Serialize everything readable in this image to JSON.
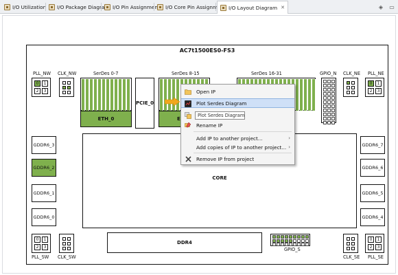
{
  "tabs": [
    {
      "label": "I/O Utilization",
      "active": false
    },
    {
      "label": "I/O Package Diagram",
      "active": false
    },
    {
      "label": "I/O Pin Assignment",
      "active": false
    },
    {
      "label": "I/O Core Pin Assignment",
      "active": false
    },
    {
      "label": "I/O Layout Diagram",
      "active": true,
      "close": "✕"
    }
  ],
  "chip": {
    "title": "AC7t1500ES0-FS3",
    "top_labels": {
      "pll_nw": "PLL_NW",
      "clk_nw": "CLK_NW",
      "serdes_0_7": "SerDes 0-7",
      "serdes_8_15": "SerDes 8-15",
      "serdes_16_31": "SerDes 16-31",
      "gpio_n": "GPIO_N",
      "clk_ne": "CLK_NE",
      "pll_ne": "PLL_NE"
    },
    "pll_nw_cells": [
      "0",
      "1",
      "2",
      "3"
    ],
    "pll_ne_cells": [
      "0",
      "1",
      "2",
      "3"
    ],
    "pll_sw_cells": [
      "0",
      "1",
      "2",
      "3"
    ],
    "pll_se_cells": [
      "0",
      "1",
      "2",
      "3"
    ],
    "eth_0": "ETH_0",
    "pcie_0": "PCIE_0",
    "eth_1_partial": "E",
    "left_gddr": [
      "GDDR6_3",
      "GDDR6_2",
      "GDDR6_1",
      "GDDR6_0"
    ],
    "right_gddr": [
      "GDDR6_7",
      "GDDR6_6",
      "GDDR6_5",
      "GDDR6_4"
    ],
    "core": "CORE",
    "ddr4": "DDR4",
    "bottom_labels": {
      "pll_sw": "PLL_SW",
      "clk_sw": "CLK_SW",
      "gpio_s": "GPIO_S",
      "clk_se": "CLK_SE",
      "pll_se": "PLL_SE"
    }
  },
  "context_menu": {
    "items": [
      {
        "label": "Open IP",
        "icon": "folder-open-icon"
      },
      {
        "label": "Plot Serdes Diagram",
        "icon": "plot-icon",
        "highlighted": true
      },
      {
        "label": "",
        "icon": "copy-icon"
      },
      {
        "label": "Rename IP",
        "icon": "rename-icon"
      },
      {
        "label": "Add IP to another project...",
        "submenu": "›"
      },
      {
        "label": "Add copies of IP to another project...",
        "submenu": "›"
      },
      {
        "label": "Remove IP from project",
        "icon": "remove-icon"
      }
    ],
    "tooltip": "Plot Serdes Diagram"
  },
  "colors": {
    "used_green": "#7fb04d",
    "highlight": "#cfe0f7",
    "arrow": "#f0a81e"
  }
}
